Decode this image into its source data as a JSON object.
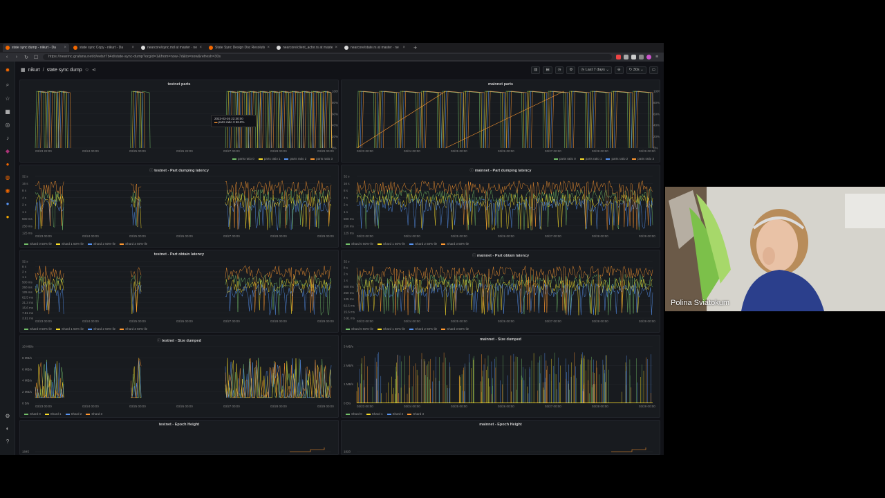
{
  "browser": {
    "tabs": [
      {
        "label": "state sync dump - nikurt - Da",
        "active": true,
        "favicon": "grafana"
      },
      {
        "label": "state sync Copy - nikurt - Da",
        "active": false,
        "favicon": "grafana"
      },
      {
        "label": "nearcore/sync.md at master · ne",
        "active": false,
        "favicon": "github"
      },
      {
        "label": "State Sync Design Doc Resolutio",
        "active": false,
        "favicon": "grafana"
      },
      {
        "label": "nearcore/client_actor.rs at maste",
        "active": false,
        "favicon": "github"
      },
      {
        "label": "nearcore/state.rs at master · ne",
        "active": false,
        "favicon": "github"
      }
    ],
    "new_tab": "+",
    "url": "https://nearinc.grafana.net/d/eeb/r7b4d/state-sync-dump?orgId=1&from=now-7d&to=now&refresh=30s"
  },
  "dashboard": {
    "breadcrumb_owner": "nikurt",
    "breadcrumb_sep": "/",
    "title": "state sync dump",
    "time_range": "Last 7 days",
    "refresh": "30s"
  },
  "panels": {
    "testnet_parts": {
      "title": "testnet parts",
      "legend": [
        "parts ratio 0",
        "parts ratio 1",
        "parts ratio 2",
        "parts ratio 3"
      ],
      "yticks": [
        "100%",
        "80%",
        "60%",
        "40%",
        "20%",
        "0%"
      ],
      "xticks": [
        "03/23 22:00",
        "03/24 00:00",
        "03/25 00:00",
        "03/26 22:00",
        "03/27 00:00",
        "03/28 00:00",
        "03/29 00:00"
      ],
      "tooltip_time": "2023-03-26 22:30:00",
      "tooltip_series": "parts ratio 3",
      "tooltip_value": "66.8%"
    },
    "mainnet_parts": {
      "title": "mainnet parts",
      "legend": [
        "parts ratio 0",
        "parts ratio 1",
        "parts ratio 2",
        "parts ratio 3"
      ],
      "yticks": [
        "100%",
        "80%",
        "60%",
        "40%",
        "20%",
        "0%"
      ],
      "xticks": [
        "03/23 00:00",
        "03/24 00:00",
        "03/25 00:00",
        "03/26 00:00",
        "03/27 00:00",
        "03/28 00:00",
        "03/29 00:00"
      ]
    },
    "testnet_dump": {
      "title": "testnet - Part dumping latency",
      "legend": [
        "Shard 0 50%-ile",
        "Shard 1 50%-ile",
        "Shard 2 50%-ile",
        "Shard 3 50%-ile"
      ],
      "yticks": [
        "32 s",
        "16 s",
        "8 s",
        "4 s",
        "2 s",
        "1 s",
        "500 ms",
        "250 ms",
        "125 ms"
      ],
      "xticks": [
        "03/23 00:00",
        "03/24 00:00",
        "03/25 00:00",
        "03/26 00:00",
        "03/27 00:00",
        "03/28 00:00",
        "03/29 00:00"
      ]
    },
    "mainnet_dump": {
      "title": "mainnet - Part dumping latency",
      "legend": [
        "Shard 0 50%-ile",
        "Shard 1 50%-ile",
        "Shard 2 50%-ile",
        "Shard 3 50%-ile"
      ],
      "yticks": [
        "32 s",
        "16 s",
        "8 s",
        "4 s",
        "2 s",
        "1 s",
        "500 ms",
        "250 ms",
        "125 ms"
      ],
      "xticks": [
        "03/23 00:00",
        "03/24 00:00",
        "03/25 00:00",
        "03/26 00:00",
        "03/27 00:00",
        "03/28 00:00",
        "03/29 00:00"
      ]
    },
    "testnet_obtain": {
      "title": "testnet - Part obtain latency",
      "legend": [
        "Shard 0 50%-ile",
        "Shard 1 50%-ile",
        "Shard 2 50%-ile",
        "Shard 3 50%-ile"
      ],
      "yticks": [
        "32 s",
        "8 s",
        "2 s",
        "1 s",
        "500 ms",
        "250 ms",
        "125 ms",
        "62.5 ms",
        "31.3 ms",
        "15.6 ms",
        "7.81 ms",
        "3.91 ms"
      ],
      "xticks": [
        "03/23 00:00",
        "03/24 00:00",
        "03/25 00:00",
        "03/26 00:00",
        "03/27 00:00",
        "03/28 00:00",
        "03/29 00:00"
      ]
    },
    "mainnet_obtain": {
      "title": "mainnet - Part obtain latency",
      "legend": [
        "Shard 0 50%-ile",
        "Shard 1 50%-ile",
        "Shard 2 50%-ile",
        "Shard 3 50%-ile"
      ],
      "yticks": [
        "32 s",
        "8 s",
        "2 s",
        "1 s",
        "500 ms",
        "250 ms",
        "125 ms",
        "62.5 ms",
        "15.6 ms",
        "3.91 ms"
      ],
      "xticks": [
        "03/23 00:00",
        "03/24 00:00",
        "03/25 00:00",
        "03/26 00:00",
        "03/27 00:00",
        "03/28 00:00",
        "03/29 00:00"
      ]
    },
    "testnet_size": {
      "title": "testnet - Size dumped",
      "legend": [
        "Shard 0",
        "Shard 1",
        "Shard 2",
        "Shard 3"
      ],
      "yticks": [
        "10 MB/s",
        "8 MB/s",
        "6 MB/s",
        "4 MB/s",
        "2 MB/s",
        "0 B/s"
      ],
      "xticks": [
        "03/23 00:00",
        "03/24 00:00",
        "03/25 00:00",
        "03/26 00:00",
        "03/27 00:00",
        "03/28 00:00",
        "03/29 00:00"
      ]
    },
    "mainnet_size": {
      "title": "mainnet - Size dumped",
      "legend": [
        "Shard 0",
        "Shard 1",
        "Shard 2",
        "Shard 3"
      ],
      "yticks": [
        "3 MB/s",
        "2 MB/s",
        "1 MB/s",
        "0 B/s"
      ],
      "xticks": [
        "03/23 00:00",
        "03/24 00:00",
        "03/25 00:00",
        "03/26 00:00",
        "03/27 00:00",
        "03/28 00:00",
        "03/29 00:00"
      ]
    },
    "testnet_epoch": {
      "title": "testnet - Epoch Height",
      "yticks": [
        "1845"
      ]
    },
    "mainnet_epoch": {
      "title": "mainnet - Epoch Height",
      "yticks": [
        "1820"
      ]
    }
  },
  "series_colors": [
    "#73bf69",
    "#fade2a",
    "#5794f2",
    "#ff9830"
  ],
  "webcam": {
    "participant_name": "Polina Sviatokum"
  }
}
